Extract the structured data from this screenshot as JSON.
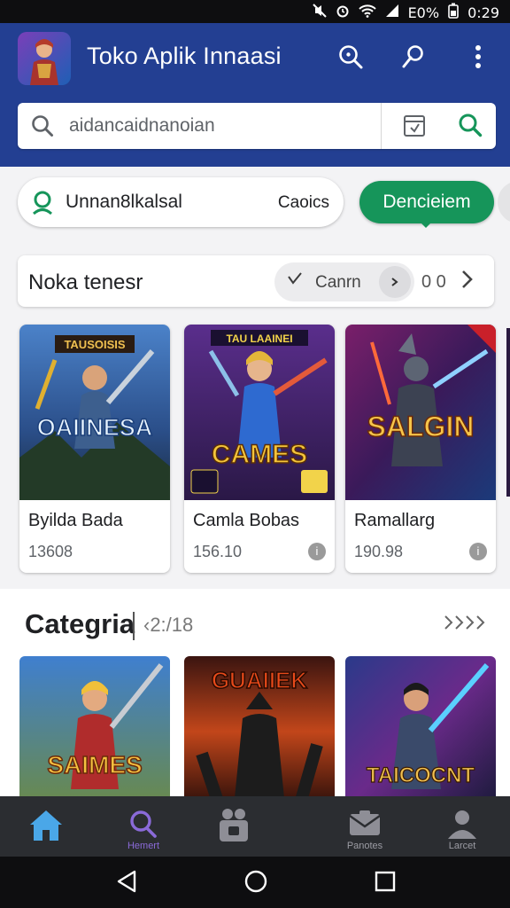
{
  "status_bar": {
    "battery": "E0%",
    "time": "0:29",
    "icons": [
      "mute-icon",
      "alarm-icon",
      "wifi-icon",
      "signal-icon",
      "battery-icon"
    ]
  },
  "app_bar": {
    "title": "Toko Aplik Innaasi",
    "actions": [
      "search-icon",
      "pin-icon",
      "more-vert-icon"
    ]
  },
  "search": {
    "placeholder": "aidancaidnanoian"
  },
  "filter": {
    "label": "Unnan8lkalsal",
    "right_label": "Caoics",
    "download_label": "Dencieiem"
  },
  "section_one": {
    "title": "Noka tenesr",
    "sort_label": "Canrn",
    "count": "0 0",
    "cards": [
      {
        "name": "Byilda Bada",
        "price": "13608",
        "art_banner": "TAUSOISIS",
        "art_title": "OAIINESA"
      },
      {
        "name": "Camla Bobas",
        "price": "156.10",
        "art_banner": "TAU LAAINEI",
        "art_title": "CAMES"
      },
      {
        "name": "Ramallarg",
        "price": "190.98",
        "art_banner": "",
        "art_title": "SALGIN"
      }
    ]
  },
  "section_two": {
    "title": "Categria",
    "subtitle": "‹2:/18",
    "tiles": [
      {
        "art_title": "SAIMES"
      },
      {
        "art_title": "GUAIIEK"
      },
      {
        "art_title": "TAICOCNT"
      }
    ]
  },
  "bottom_nav": [
    {
      "icon": "home-icon",
      "label": ""
    },
    {
      "icon": "search-icon",
      "label": "Hemert"
    },
    {
      "icon": "film-camera-icon",
      "label": ""
    },
    {
      "icon": "inbox-icon",
      "label": "Panotes"
    },
    {
      "icon": "person-icon",
      "label": "Larcet"
    }
  ],
  "colors": {
    "primary": "#233f92",
    "accent_green": "#16955a",
    "nav_active": "#4aa7e8"
  }
}
